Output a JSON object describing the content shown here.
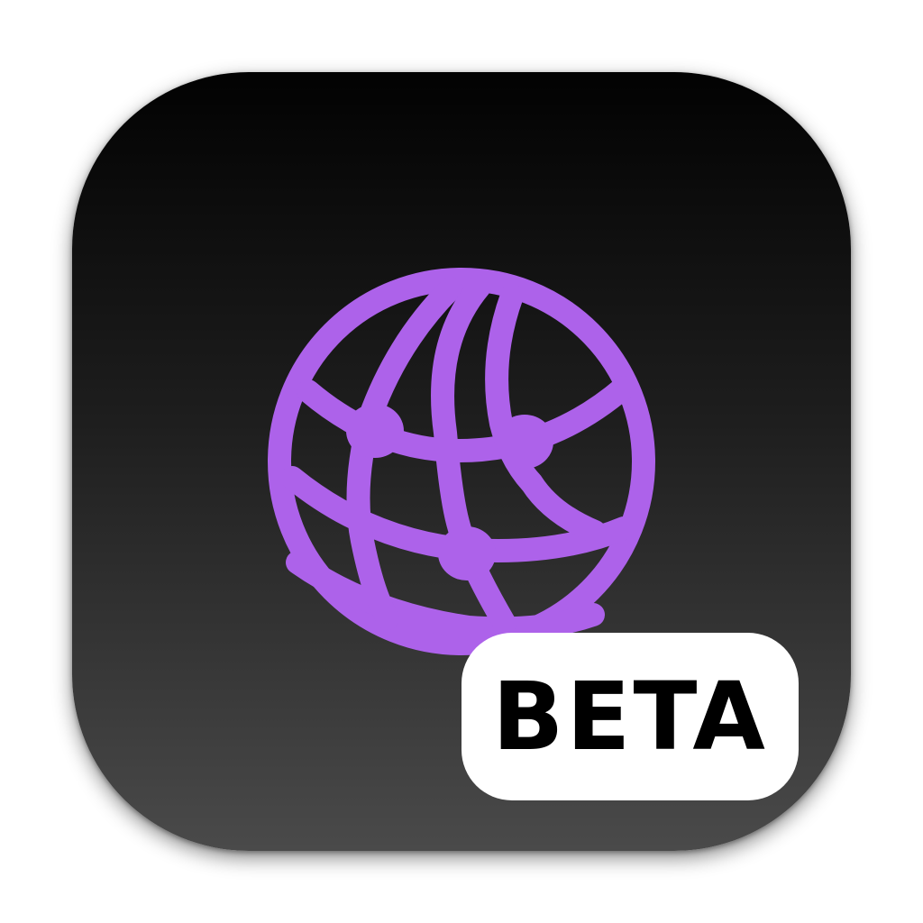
{
  "icon": {
    "name": "globe-network-icon",
    "accent_color": "#AD62EA",
    "background_top": "#020202",
    "background_bottom": "#4A4A4A"
  },
  "badge": {
    "label": "BETA",
    "background": "#FFFFFF",
    "text_color": "#000000"
  }
}
